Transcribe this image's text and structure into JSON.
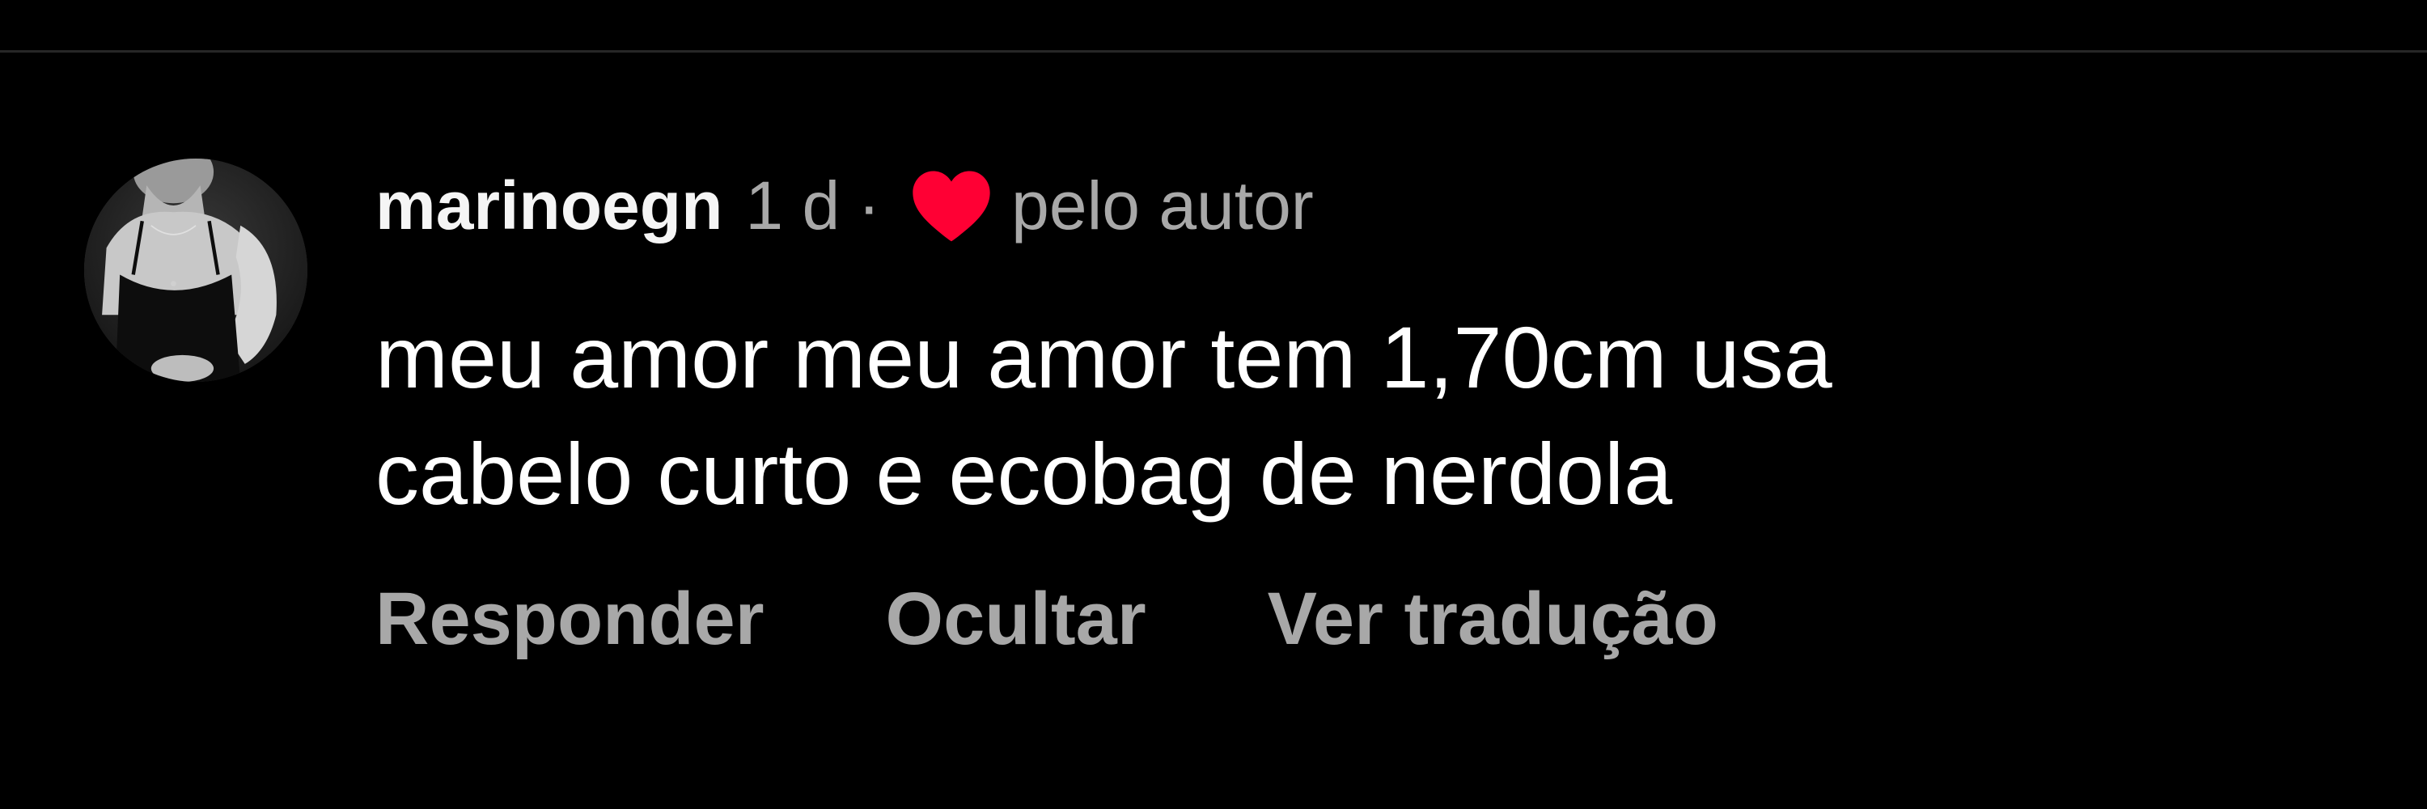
{
  "comment": {
    "username": "marinoegn",
    "time": "1 d",
    "separator": "·",
    "liked_by_label": "pelo autor",
    "text_lines": [
      "meu amor meu amor tem 1,70cm usa",
      "cabelo curto e ecobag de nerdola"
    ],
    "actions": {
      "reply": "Responder",
      "hide": "Ocultar",
      "translate": "Ver tradução"
    },
    "heart_color": "#ff0034",
    "secondary_text_color": "#a8a8a8",
    "icons": {
      "avatar": "profile-photo",
      "liked": "heart-icon"
    }
  }
}
